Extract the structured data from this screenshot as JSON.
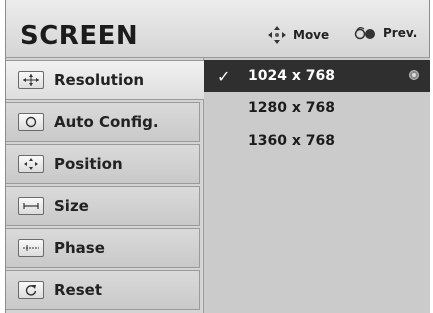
{
  "header": {
    "title": "SCREEN",
    "hints": [
      {
        "label": "Move",
        "icon": "move-arrows-icon"
      },
      {
        "label": "Prev.",
        "icon": "back-icon"
      }
    ]
  },
  "sidebar": {
    "items": [
      {
        "label": "Resolution",
        "icon": "resolution-icon",
        "selected": true
      },
      {
        "label": "Auto Config.",
        "icon": "auto-config-icon"
      },
      {
        "label": "Position",
        "icon": "position-icon"
      },
      {
        "label": "Size",
        "icon": "size-icon"
      },
      {
        "label": "Phase",
        "icon": "phase-icon"
      },
      {
        "label": "Reset",
        "icon": "reset-icon"
      }
    ]
  },
  "options": [
    {
      "label": "1024 x 768",
      "selected": true
    },
    {
      "label": "1280 x 768"
    },
    {
      "label": "1360 x 768"
    }
  ],
  "colors": {
    "selected_row": "#2f2f2f",
    "panel": "#cbcbcb",
    "sidebar": "#d4d4d4"
  }
}
